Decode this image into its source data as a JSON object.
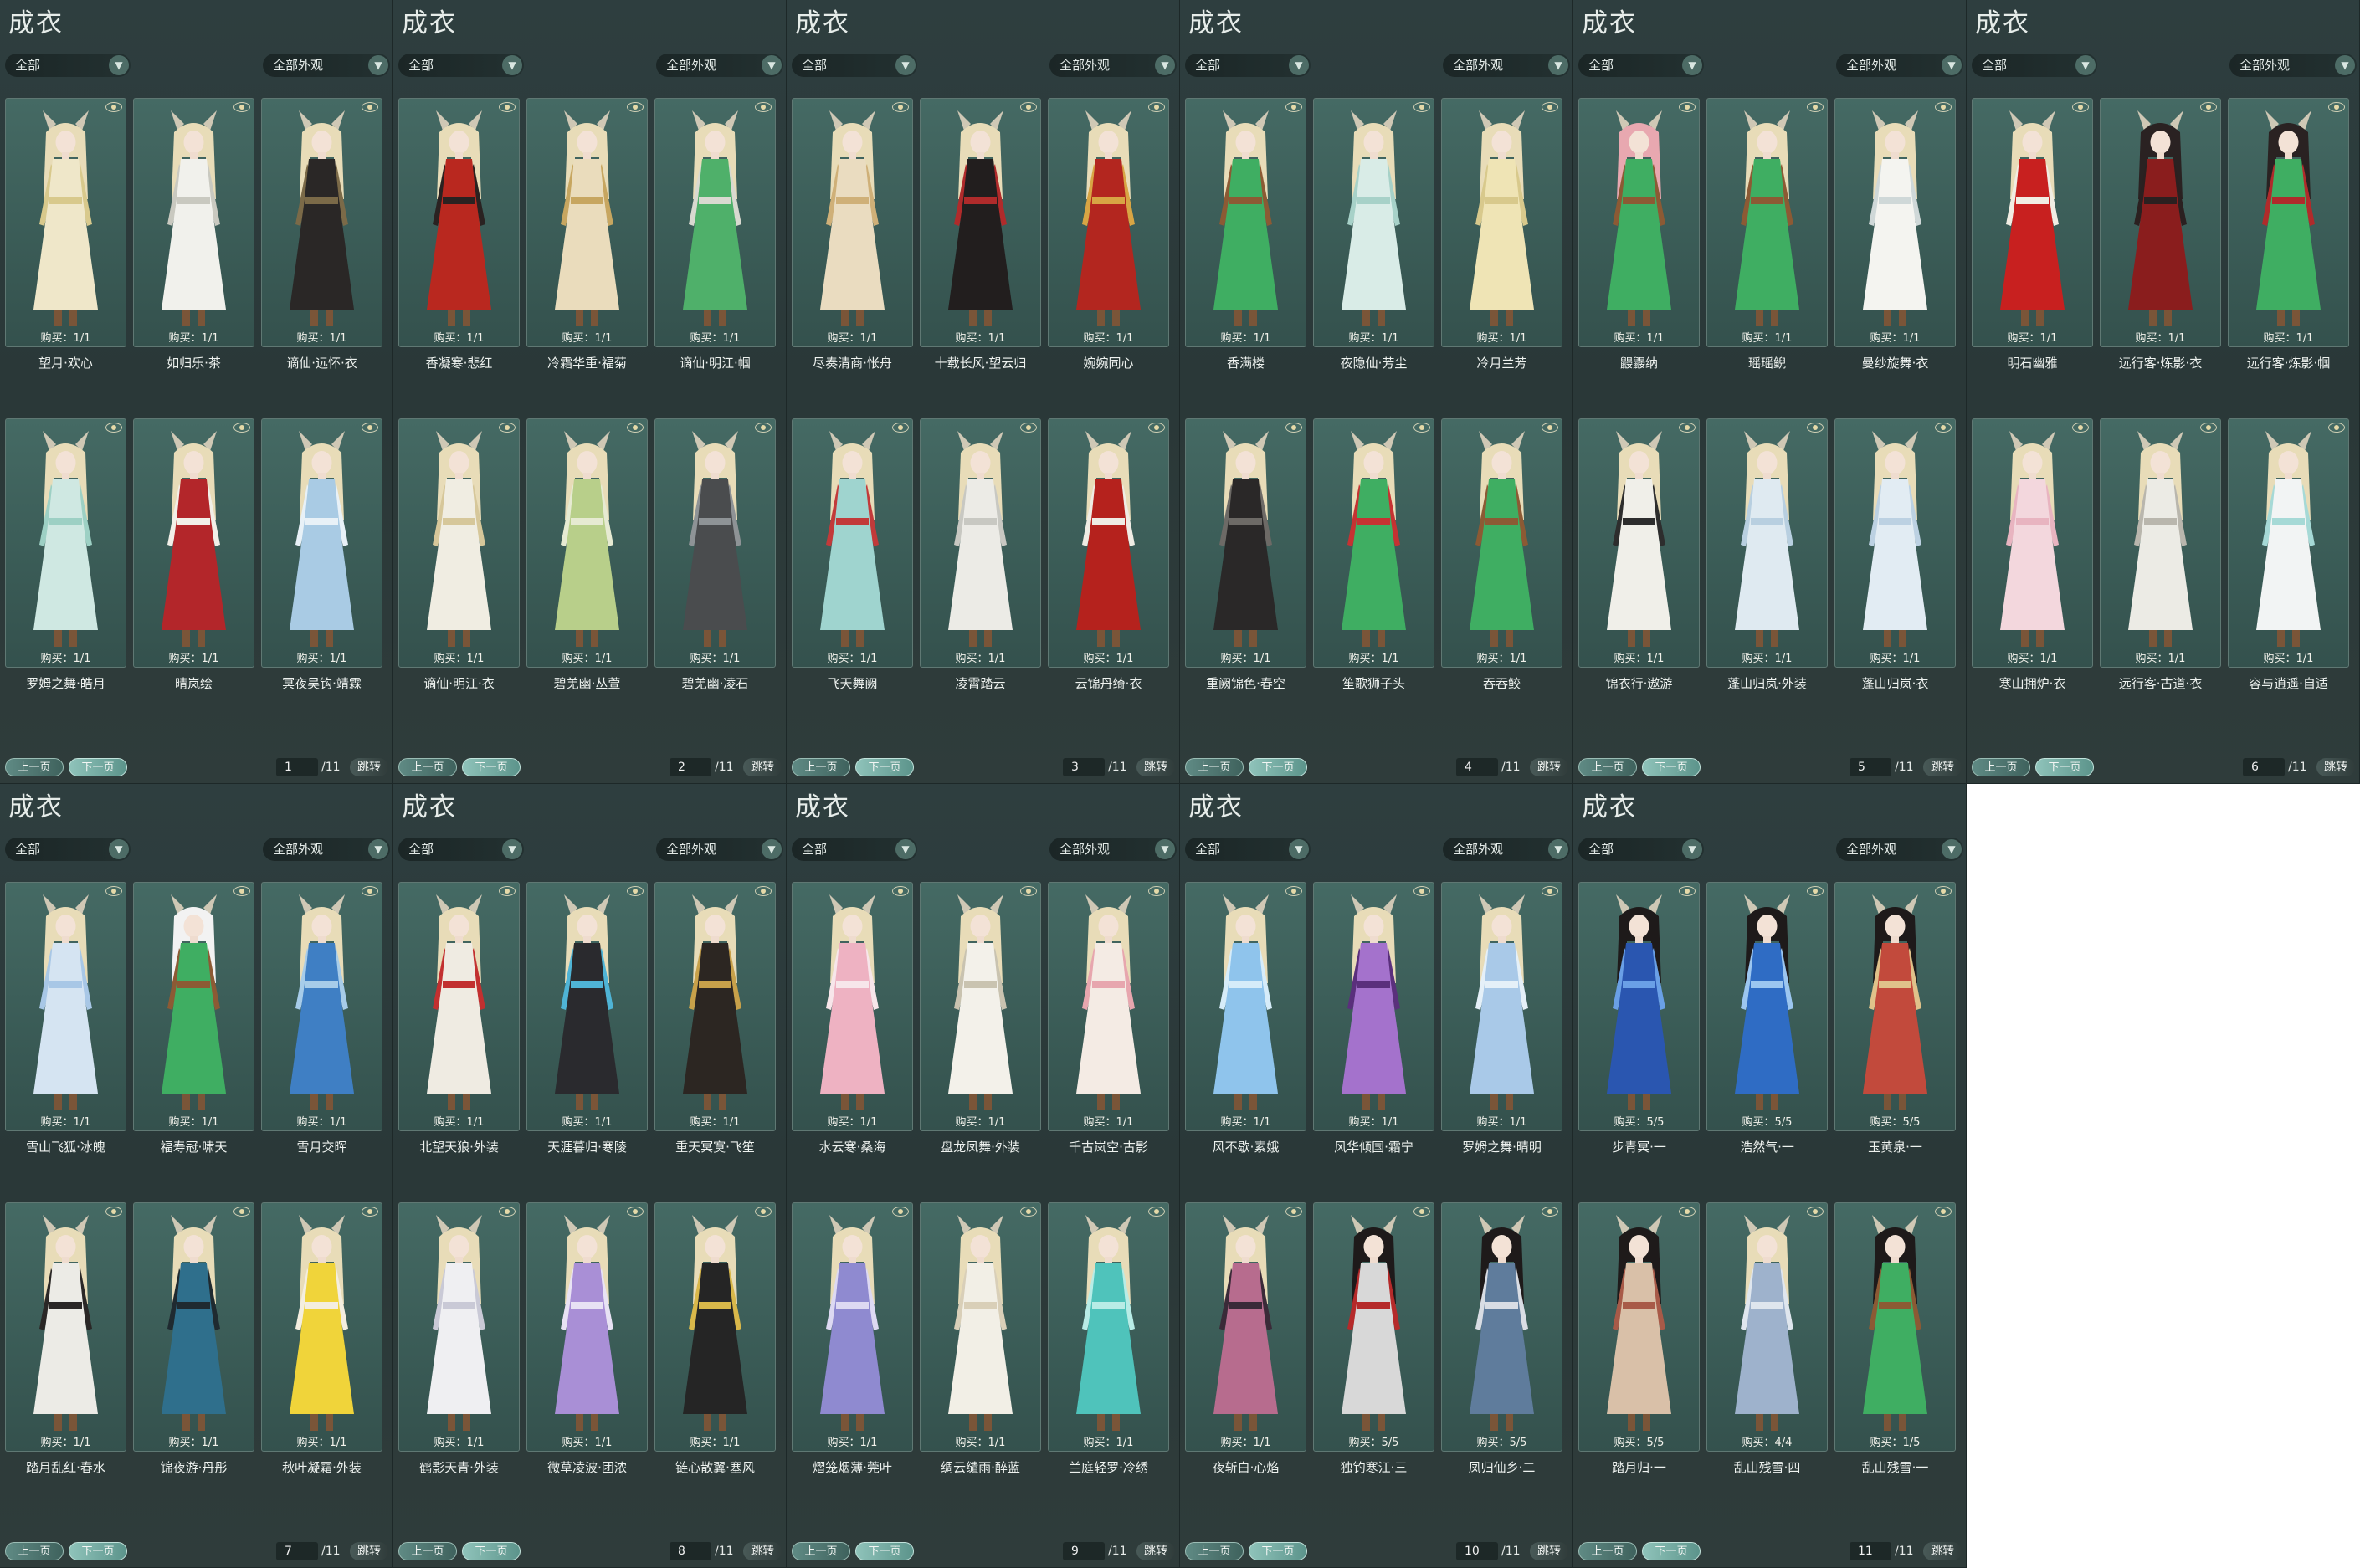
{
  "colors": {
    "panel_bg": "#2d3b3b",
    "card_bg": "#3f625c",
    "next_button": "#7fb6ad",
    "text": "#eef2ef"
  },
  "ui": {
    "title": "成衣",
    "filter_category": "全部",
    "filter_look": "全部外观",
    "dropdown_icon": "chevron-down-icon",
    "view_icon": "eye-icon",
    "prev_page": "上一页",
    "next_page": "下一页",
    "total_pages": "/11",
    "jump": "跳转"
  },
  "panels": [
    {
      "page": "1",
      "items": [
        {
          "name": "望月·欢心",
          "buy": "购买：1/1",
          "hair": "#e8dcb8",
          "dress": "#efe7c9",
          "accent": "#d8c98c"
        },
        {
          "name": "如归乐·茶",
          "buy": "购买：1/1",
          "hair": "#e8dcb8",
          "dress": "#f1f1ec",
          "accent": "#c9c9c0"
        },
        {
          "name": "谪仙·远怀·衣",
          "buy": "购买：1/1",
          "hair": "#e8dcb8",
          "dress": "#2a2726",
          "accent": "#7b6a48"
        },
        {
          "name": "罗姆之舞·皓月",
          "buy": "购买：1/1",
          "hair": "#e8dcb8",
          "dress": "#cfe8e2",
          "accent": "#9dd0c4"
        },
        {
          "name": "晴岚绘",
          "buy": "购买：1/1",
          "hair": "#e8dcb8",
          "dress": "#b3262a",
          "accent": "#f2efe8"
        },
        {
          "name": "冥夜吴钩·靖霖",
          "buy": "购买：1/1",
          "hair": "#e8dcb8",
          "dress": "#a9cbe4",
          "accent": "#e8f1f7"
        }
      ]
    },
    {
      "page": "2",
      "items": [
        {
          "name": "香凝寒·悲红",
          "buy": "购买：1/1",
          "hair": "#e8dcb8",
          "dress": "#b9281f",
          "accent": "#2a2221"
        },
        {
          "name": "冷霜华重·福菊",
          "buy": "购买：1/1",
          "hair": "#e8dcb8",
          "dress": "#eadcbc",
          "accent": "#c7a660"
        },
        {
          "name": "谪仙·明江·帼",
          "buy": "购买：1/1",
          "hair": "#e8dcb8",
          "dress": "#4fb06a",
          "accent": "#d9d9d0"
        },
        {
          "name": "谪仙·明江·衣",
          "buy": "购买：1/1",
          "hair": "#e8dcb8",
          "dress": "#f0ede2",
          "accent": "#d6c79a"
        },
        {
          "name": "碧羌幽·丛萱",
          "buy": "购买：1/1",
          "hair": "#e8dcb8",
          "dress": "#b8cf8a",
          "accent": "#e6ead2"
        },
        {
          "name": "碧羌幽·凌石",
          "buy": "购买：1/1",
          "hair": "#e8dcb8",
          "dress": "#4a4c4e",
          "accent": "#8e9396"
        }
      ]
    },
    {
      "page": "3",
      "items": [
        {
          "name": "尽奏清商·怅舟",
          "buy": "购买：1/1",
          "hair": "#e8dcb8",
          "dress": "#eadcc0",
          "accent": "#cfb078"
        },
        {
          "name": "十载长风·望云归",
          "buy": "购买：1/1",
          "hair": "#e8dcb8",
          "dress": "#221e1e",
          "accent": "#b02b2b"
        },
        {
          "name": "婉婉同心",
          "buy": "购买：1/1",
          "hair": "#e8dcb8",
          "dress": "#b3261f",
          "accent": "#d8a544"
        },
        {
          "name": "飞天舞阙",
          "buy": "购买：1/1",
          "hair": "#e8dcb8",
          "dress": "#9fd4cf",
          "accent": "#c23a3a"
        },
        {
          "name": "凌霄踏云",
          "buy": "购买：1/1",
          "hair": "#e8dcb8",
          "dress": "#ecebe6",
          "accent": "#c8c8c2"
        },
        {
          "name": "云锦丹绮·衣",
          "buy": "购买：1/1",
          "hair": "#e8dcb8",
          "dress": "#b5221d",
          "accent": "#efece4"
        }
      ]
    },
    {
      "page": "4",
      "items": [
        {
          "name": "香满楼",
          "buy": "购买：1/1",
          "hair": "#e8dcb8",
          "dress": "#3fae62",
          "accent": "#8c5a34"
        },
        {
          "name": "夜隐仙·芳尘",
          "buy": "购买：1/1",
          "hair": "#e8dcb8",
          "dress": "#d9ece7",
          "accent": "#a7d1c8"
        },
        {
          "name": "冷月兰芳",
          "buy": "购买：1/1",
          "hair": "#e8dcb8",
          "dress": "#efe4b5",
          "accent": "#d8c98c"
        },
        {
          "name": "重阙锦色·春空",
          "buy": "购买：1/1",
          "hair": "#e8dcb8",
          "dress": "#2a2828",
          "accent": "#6d6a66"
        },
        {
          "name": "笙歌狮子头",
          "buy": "购买：1/1",
          "hair": "#e8dcb8",
          "dress": "#3fae62",
          "accent": "#c63232"
        },
        {
          "name": "吞吞鲛",
          "buy": "购买：1/1",
          "hair": "#e8dcb8",
          "dress": "#3fae62",
          "accent": "#8c5a34"
        }
      ]
    },
    {
      "page": "5",
      "items": [
        {
          "name": "鼹鼹纳",
          "buy": "购买：1/1",
          "hair": "#e8a8b0",
          "dress": "#3fae62",
          "accent": "#8c5a34"
        },
        {
          "name": "瑶瑶鲵",
          "buy": "购买：1/1",
          "hair": "#e8dcb8",
          "dress": "#3fae62",
          "accent": "#8c5a34"
        },
        {
          "name": "曼纱旋舞·衣",
          "buy": "购买：1/1",
          "hair": "#e8dcb8",
          "dress": "#f4f4f0",
          "accent": "#cfd8d8"
        },
        {
          "name": "锦衣行·遨游",
          "buy": "购买：1/1",
          "hair": "#e8dcb8",
          "dress": "#f0efe9",
          "accent": "#2d2d2d"
        },
        {
          "name": "蓬山归岚·外装",
          "buy": "购买：1/1",
          "hair": "#e8dcb8",
          "dress": "#dfeaf1",
          "accent": "#b8cfe0"
        },
        {
          "name": "蓬山归岚·衣",
          "buy": "购买：1/1",
          "hair": "#e8dcb8",
          "dress": "#e2ecf3",
          "accent": "#bcd1e2"
        }
      ]
    },
    {
      "page": "6",
      "items": [
        {
          "name": "明石幽雅",
          "buy": "购买：1/1",
          "hair": "#e8dcb8",
          "dress": "#c8201f",
          "accent": "#f1ede3"
        },
        {
          "name": "远行客·炼影·衣",
          "buy": "购买：1/1",
          "hair": "#2a2222",
          "dress": "#8a1d1d",
          "accent": "#2b2020"
        },
        {
          "name": "远行客·炼影·帼",
          "buy": "购买：1/1",
          "hair": "#2a2222",
          "dress": "#3fae62",
          "accent": "#b02b2b"
        },
        {
          "name": "寒山拥炉·衣",
          "buy": "购买：1/1",
          "hair": "#e8dcb8",
          "dress": "#f3d7dd",
          "accent": "#e8b4c0"
        },
        {
          "name": "远行客·古道·衣",
          "buy": "购买：1/1",
          "hair": "#e8dcb8",
          "dress": "#ecebe5",
          "accent": "#b9b6ad"
        },
        {
          "name": "容与逍遥·自适",
          "buy": "购买：1/1",
          "hair": "#e8dcb8",
          "dress": "#f2f4f4",
          "accent": "#a6d9d6"
        }
      ]
    },
    {
      "page": "7",
      "items": [
        {
          "name": "雪山飞狐·冰魄",
          "buy": "购买：1/1",
          "hair": "#e8dcb8",
          "dress": "#d5e4f2",
          "accent": "#a8c7e6"
        },
        {
          "name": "福寿冠·啸天",
          "buy": "购买：1/1",
          "hair": "#f2f2f2",
          "dress": "#3fae62",
          "accent": "#8c5a34"
        },
        {
          "name": "雪月交晖",
          "buy": "购买：1/1",
          "hair": "#e8dcb8",
          "dress": "#3f7fc4",
          "accent": "#a7cce9"
        },
        {
          "name": "踏月乱红·春水",
          "buy": "购买：1/1",
          "hair": "#e8dcb8",
          "dress": "#ecebe6",
          "accent": "#2a2726"
        },
        {
          "name": "锦夜游·丹彤",
          "buy": "购买：1/1",
          "hair": "#e8dcb8",
          "dress": "#2f6f8c",
          "accent": "#1f2a30"
        },
        {
          "name": "秋叶凝霜·外装",
          "buy": "购买：1/1",
          "hair": "#e8dcb8",
          "dress": "#f0d43a",
          "accent": "#f4eee0"
        }
      ]
    },
    {
      "page": "8",
      "items": [
        {
          "name": "北望天狼·外装",
          "buy": "购买：1/1",
          "hair": "#e8dcb8",
          "dress": "#efebe2",
          "accent": "#c23030"
        },
        {
          "name": "天涯暮归·寒陵",
          "buy": "购买：1/1",
          "hair": "#e8dcb8",
          "dress": "#2a2a2e",
          "accent": "#4fb4d6"
        },
        {
          "name": "重天冥寞·飞笙",
          "buy": "购买：1/1",
          "hair": "#e8dcb8",
          "dress": "#2c2622",
          "accent": "#c8a14a"
        },
        {
          "name": "鹤影天青·外装",
          "buy": "购买：1/1",
          "hair": "#e8dcb8",
          "dress": "#efeff2",
          "accent": "#c9c9d6"
        },
        {
          "name": "微草凌波·团浓",
          "buy": "购买：1/1",
          "hair": "#e8dcb8",
          "dress": "#a98fd6",
          "accent": "#e8e2f4"
        },
        {
          "name": "链心散翼·塞风",
          "buy": "购买：1/1",
          "hair": "#e8dcb8",
          "dress": "#252525",
          "accent": "#d9b84a"
        }
      ]
    },
    {
      "page": "9",
      "items": [
        {
          "name": "水云寒·桑海",
          "buy": "购买：1/1",
          "hair": "#e8dcb8",
          "dress": "#eeb2c2",
          "accent": "#f7e6ea"
        },
        {
          "name": "盘龙凤舞·外装",
          "buy": "购买：1/1",
          "hair": "#e8dcb8",
          "dress": "#f3f1ea",
          "accent": "#c9c3b0"
        },
        {
          "name": "千古岚空·古影",
          "buy": "购买：1/1",
          "hair": "#e8dcb8",
          "dress": "#f4ebe4",
          "accent": "#e7a6ae"
        },
        {
          "name": "熠笼烟薄·莞叶",
          "buy": "购买：1/1",
          "hair": "#e8dcb8",
          "dress": "#8f8ad0",
          "accent": "#ddd9f2"
        },
        {
          "name": "绸云缱雨·醉蓝",
          "buy": "购买：1/1",
          "hair": "#e8dcb8",
          "dress": "#f2efe6",
          "accent": "#d9cfb8"
        },
        {
          "name": "兰庭轻罗·冷绣",
          "buy": "购买：1/1",
          "hair": "#e8dcb8",
          "dress": "#4fc3bb",
          "accent": "#b8ece6"
        }
      ]
    },
    {
      "page": "10",
      "items": [
        {
          "name": "风不歇·素娥",
          "buy": "购买：1/1",
          "hair": "#e8dcb8",
          "dress": "#8fc4ec",
          "accent": "#d6ecf9"
        },
        {
          "name": "风华倾国·霜宁",
          "buy": "购买：1/1",
          "hair": "#e8dcb8",
          "dress": "#a472cc",
          "accent": "#5a2f7c"
        },
        {
          "name": "罗姆之舞·晴明",
          "buy": "购买：1/1",
          "hair": "#e8dcb8",
          "dress": "#a9c9e8",
          "accent": "#e5f0f8"
        },
        {
          "name": "夜斩白·心焰",
          "buy": "购买：1/1",
          "hair": "#e8dcb8",
          "dress": "#b76c8e",
          "accent": "#3a2a38"
        },
        {
          "name": "独钓寒江·三",
          "buy": "购买：5/5",
          "hair": "#1e1a1a",
          "dress": "#d8d8d8",
          "accent": "#b52a2a"
        },
        {
          "name": "凤归仙乡·二",
          "buy": "购买：5/5",
          "hair": "#1e1a1a",
          "dress": "#5f7c9c",
          "accent": "#d9dde4"
        }
      ]
    },
    {
      "page": "11",
      "items": [
        {
          "name": "步青冥·一",
          "buy": "购买：5/5",
          "hair": "#1e1a1a",
          "dress": "#2a56b0",
          "accent": "#6aa0e6"
        },
        {
          "name": "浩然气·一",
          "buy": "购买：5/5",
          "hair": "#1e1a1a",
          "dress": "#2f6cc4",
          "accent": "#9cc6f0"
        },
        {
          "name": "玉黄泉·一",
          "buy": "购买：5/5",
          "hair": "#1e1a1a",
          "dress": "#c24a3c",
          "accent": "#e0c28a"
        },
        {
          "name": "踏月归·一",
          "buy": "购买：5/5",
          "hair": "#1e1a1a",
          "dress": "#d9c0a8",
          "accent": "#a85a48"
        },
        {
          "name": "乱山残雪·四",
          "buy": "购买：4/4",
          "hair": "#e8dcb8",
          "dress": "#9eb2cc",
          "accent": "#dfe6ee"
        },
        {
          "name": "乱山残雪·一",
          "buy": "购买：1/5",
          "hair": "#1e1a1a",
          "dress": "#3fae62",
          "accent": "#8c5a34"
        }
      ]
    }
  ]
}
